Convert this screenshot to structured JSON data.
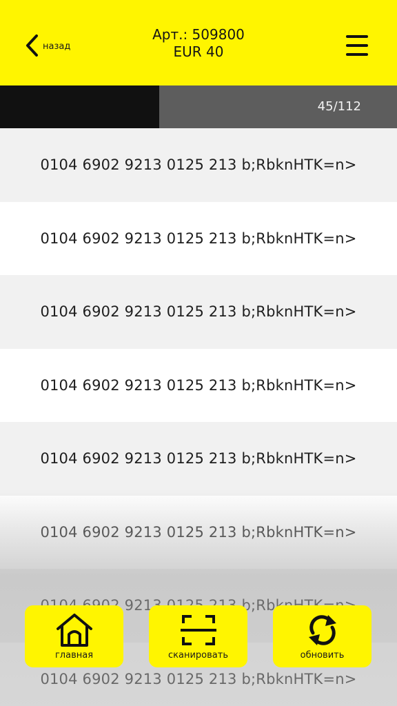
{
  "header": {
    "back_label": "назад",
    "article": "Арт.: 509800",
    "price": "EUR 40"
  },
  "progress": {
    "current": 45,
    "total": 112,
    "label": "45/112"
  },
  "codes": [
    "0104 6902 9213 0125 213 b;RbknHTK=n>",
    "0104 6902 9213 0125 213 b;RbknHTK=n>",
    "0104 6902 9213 0125 213 b;RbknHTK=n>",
    "0104 6902 9213 0125 213 b;RbknHTK=n>",
    "0104 6902 9213 0125 213 b;RbknHTK=n>",
    "0104 6902 9213 0125 213 b;RbknHTK=n>",
    "0104 6902 9213 0125 213 b;RbknHTK=n>",
    "0104 6902 9213 0125 213 b;RbknHTK=n>"
  ],
  "tabs": {
    "home": {
      "label": "главная",
      "icon": "home-icon"
    },
    "scan": {
      "label": "сканировать",
      "icon": "scan-icon"
    },
    "refresh": {
      "label": "обновить",
      "icon": "refresh-icon"
    }
  },
  "colors": {
    "accent": "#fff500",
    "progress_fill": "#111111",
    "progress_track": "#5d5d5d",
    "row_alt": "#f1f1f1"
  }
}
